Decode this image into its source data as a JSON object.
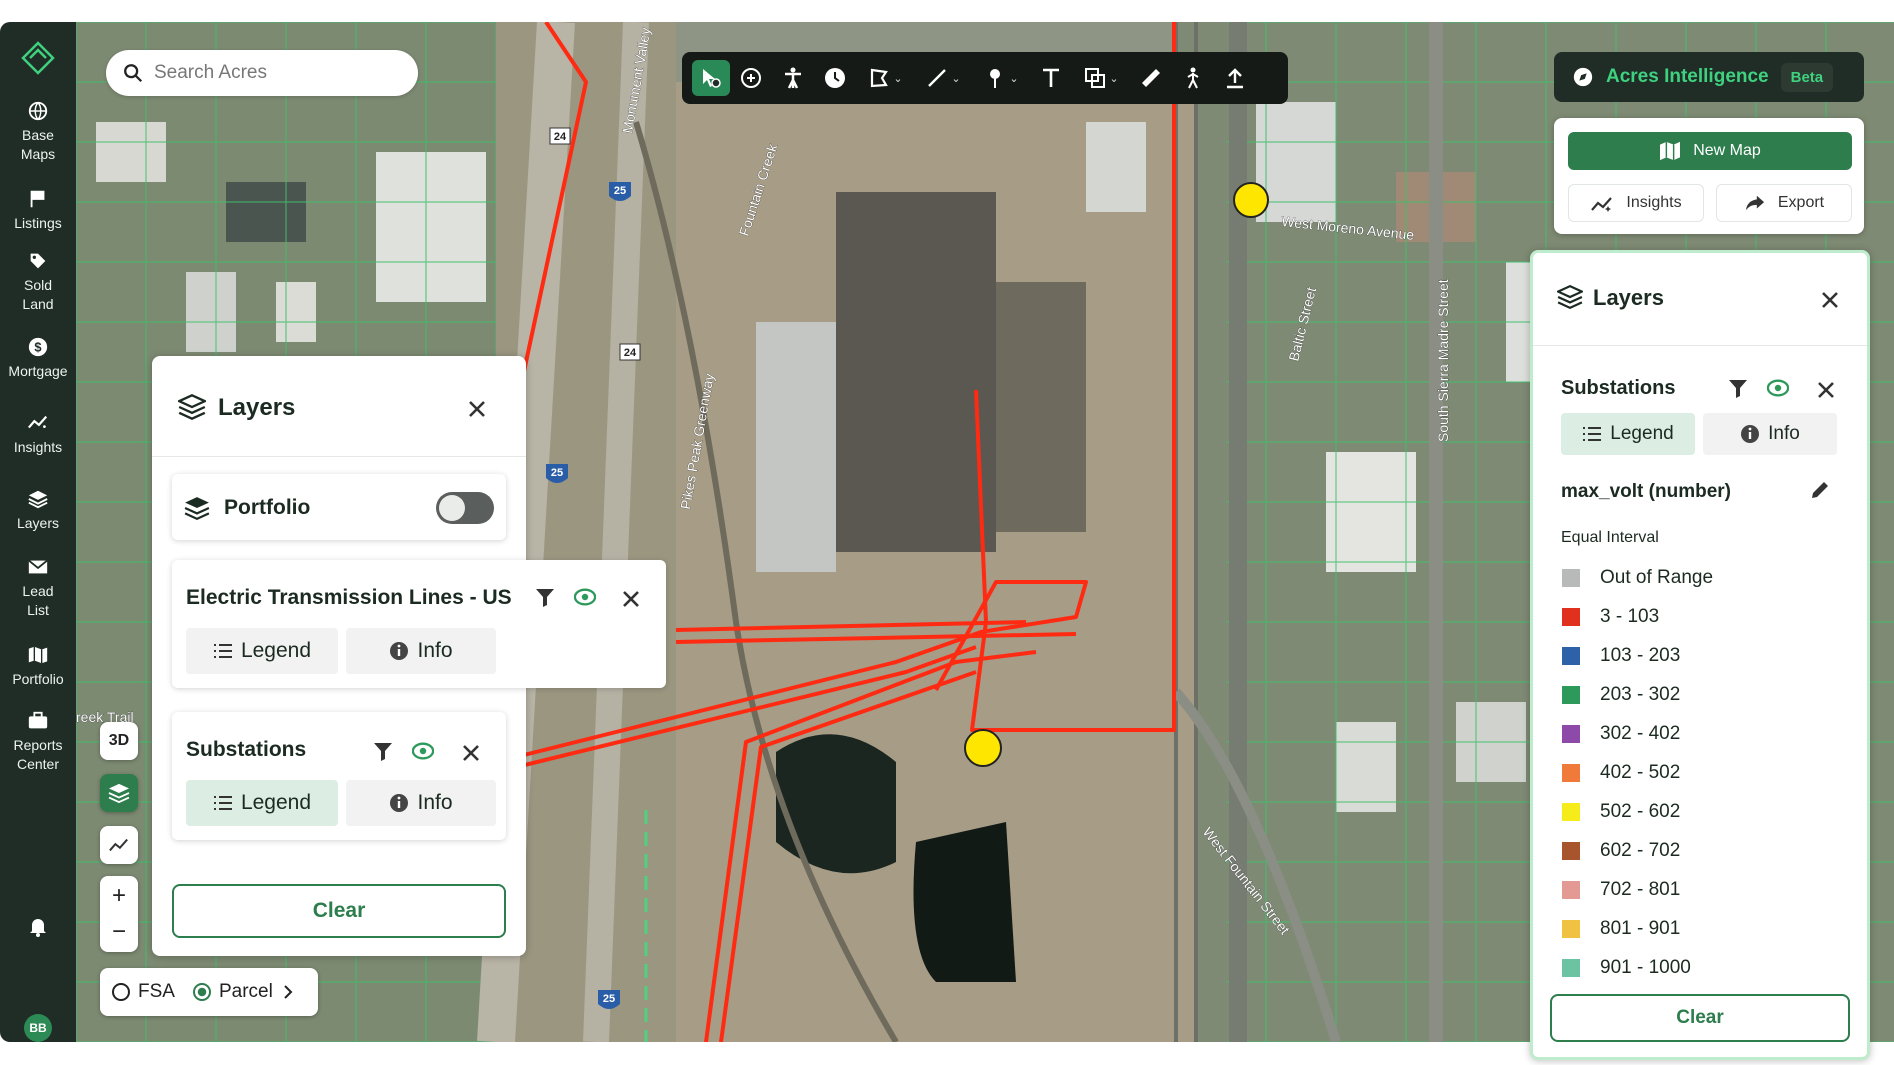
{
  "search": {
    "placeholder": "Search Acres"
  },
  "sidebar": {
    "items": [
      {
        "label": "Base\nMaps",
        "icon": "globe-icon"
      },
      {
        "label": "Listings",
        "icon": "flag-icon"
      },
      {
        "label": "Sold\nLand",
        "icon": "tag-icon"
      },
      {
        "label": "Mortgage",
        "icon": "dollar-icon"
      },
      {
        "label": "Insights",
        "icon": "sparkline-icon"
      },
      {
        "label": "Layers",
        "icon": "layers-icon"
      },
      {
        "label": "Lead\nList",
        "icon": "mail-icon"
      },
      {
        "label": "Portfolio",
        "icon": "map-icon"
      },
      {
        "label": "Reports\nCenter",
        "icon": "briefcase-icon"
      }
    ],
    "avatar": "BB"
  },
  "toolbar": {
    "tools": [
      "select-tool-icon",
      "add-point-icon",
      "person-icon",
      "clock-icon",
      "polygon-tool-icon",
      "line-tool-icon",
      "pin-tool-icon",
      "text-tool-icon",
      "shape-tool-icon",
      "ruler-icon",
      "walk-icon",
      "upload-icon"
    ]
  },
  "intelligence": {
    "title": "Acres Intelligence",
    "badge": "Beta"
  },
  "actions": {
    "new_map": "New Map",
    "insights": "Insights",
    "export": "Export"
  },
  "left_layers": {
    "title": "Layers",
    "portfolio": {
      "label": "Portfolio",
      "enabled": false
    },
    "cards": [
      {
        "title": "Electric Transmission Lines - US",
        "legend": "Legend",
        "info": "Info"
      },
      {
        "title": "Substations",
        "legend": "Legend",
        "info": "Info"
      }
    ],
    "clear": "Clear"
  },
  "right_layers": {
    "title": "Layers",
    "card_title": "Substations",
    "legend": "Legend",
    "info": "Info",
    "field": "max_volt (number)",
    "classification": "Equal Interval",
    "legend_items": [
      {
        "label": "Out of Range",
        "color": "#b7bab8"
      },
      {
        "label": "3 - 103",
        "color": "#e0301e"
      },
      {
        "label": "103 - 203",
        "color": "#2e62a8"
      },
      {
        "label": "203 - 302",
        "color": "#2d9a5c"
      },
      {
        "label": "302 - 402",
        "color": "#8e4aa8"
      },
      {
        "label": "402 - 502",
        "color": "#f07a3a"
      },
      {
        "label": "502 - 602",
        "color": "#f5ec19"
      },
      {
        "label": "602 - 702",
        "color": "#a8552e"
      },
      {
        "label": "702 - 801",
        "color": "#e39a94"
      },
      {
        "label": "801 - 901",
        "color": "#f0c242"
      },
      {
        "label": "901 - 1000",
        "color": "#6cc3a2"
      }
    ],
    "clear": "Clear"
  },
  "map_controls": {
    "mode_3d": "3D",
    "zoom_in": "+",
    "zoom_out": "−",
    "fsa": "FSA",
    "parcel": "Parcel"
  },
  "map_labels": {
    "west_moreno": "West Moreno Avenue",
    "monument_valley": "Monument Valley",
    "fountain_creek": "Fountain Creek",
    "pikes_peak_greenway": "Pikes Peak Greenway",
    "baltic_street": "Baltic Street",
    "sierra_madre": "South Sierra Madre Street",
    "west_fountain": "West Fountain Street",
    "creek_trail": "reek Trail",
    "interstate": "25",
    "highway": "24"
  },
  "colors": {
    "accent": "#2d7d4d",
    "line": "#ff2a12",
    "substation": "#ffe600"
  }
}
